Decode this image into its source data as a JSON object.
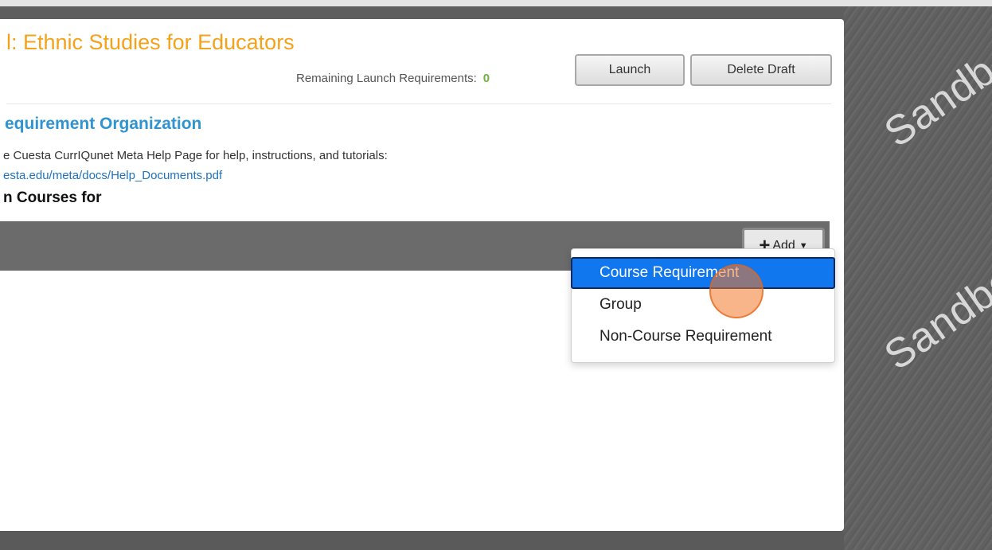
{
  "page": {
    "title": "l: Ethnic Studies for Educators",
    "remaining_label": "Remaining Launch Requirements:",
    "remaining_count": "0",
    "launch_label": "Launch",
    "delete_label": "Delete Draft",
    "section_title": "equirement Organization",
    "help_text": "e Cuesta CurrIQunet Meta Help Page for help, instructions, and tutorials:",
    "help_link": "esta.edu/meta/docs/Help_Documents.pdf",
    "courses_heading": "n Courses for"
  },
  "add_button": {
    "icon": "plus-icon",
    "label": "Add",
    "caret": "caret-down-icon"
  },
  "dropdown": {
    "items": [
      {
        "label": "Course Requirement",
        "active": true
      },
      {
        "label": "Group",
        "active": false
      },
      {
        "label": "Non-Course Requirement",
        "active": false
      }
    ]
  },
  "watermark": {
    "text": "Sandbox",
    "visible_fragments": [
      "Sandb",
      "Sandbo",
      "Sandbo"
    ]
  },
  "colors": {
    "title": "#f5a21b",
    "link": "#2f94d1",
    "count": "#6db33f",
    "menu_active": "#1177ee",
    "cursor": "#f27828"
  }
}
